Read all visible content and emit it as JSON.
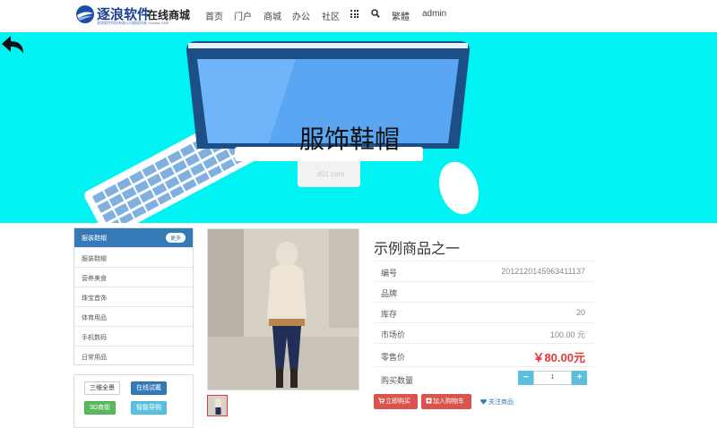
{
  "header": {
    "logo_text": "逐浪软件",
    "logo_sub": "逐浪软件科技有限公司版权所有 Zoomla CMS",
    "site_title": "在线商城",
    "nav": [
      "首页",
      "门户",
      "商城",
      "办公",
      "社区"
    ],
    "traditional": "繁體",
    "user": "admin"
  },
  "banner": {
    "title": "服饰鞋帽",
    "watermark": "z01.com",
    "bg_color": "#00f3f3"
  },
  "sidebar": {
    "heading": "服装鞋帽",
    "more": "更多",
    "items": [
      "服装鞋帽",
      "营养美食",
      "珠宝首饰",
      "体育用品",
      "手机数码",
      "日常用品"
    ],
    "tags": [
      "三维全景",
      "在线试戴",
      "3D商街",
      "智能导购"
    ]
  },
  "product": {
    "name": "示例商品之一",
    "rows": {
      "code_label": "编号",
      "code": "2012120145963411137",
      "brand_label": "品牌",
      "brand": "",
      "stock_label": "库存",
      "stock": "20",
      "market_label": "市场价",
      "market_price": "100.00 元",
      "price_label": "零售价",
      "price": "￥80.00元",
      "qty_label": "购买数量"
    },
    "qty": "1",
    "buy_now": "立即购买",
    "add_cart": "加入购物车",
    "follow": "关注商品"
  },
  "colors": {
    "accent": "#337ab7",
    "danger": "#d9534f",
    "price": "#e4393c"
  }
}
